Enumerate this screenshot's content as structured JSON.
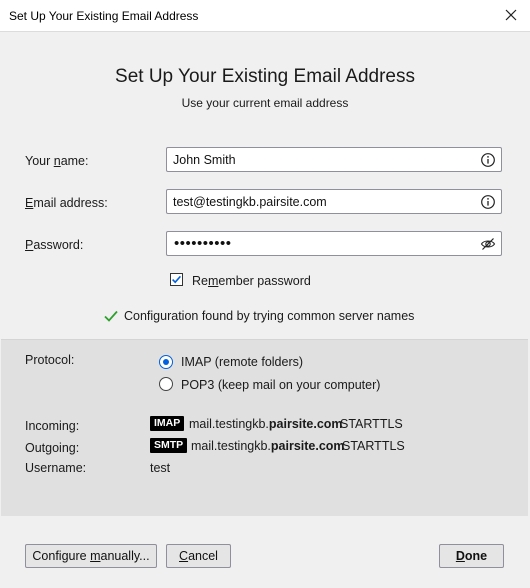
{
  "window": {
    "title": "Set Up Your Existing Email Address"
  },
  "header": {
    "title": "Set Up Your Existing Email Address",
    "subtitle": "Use your current email address"
  },
  "form": {
    "name": {
      "label_pre": "Your ",
      "label_key": "n",
      "label_post": "ame:",
      "value": "John Smith",
      "icon": "info-icon"
    },
    "email": {
      "label_pre": "",
      "label_key": "E",
      "label_post": "mail address:",
      "value": "test@testingkb.pairsite.com",
      "icon": "info-icon"
    },
    "password": {
      "label_pre": "",
      "label_key": "P",
      "label_post": "assword:",
      "value": "••••••••••",
      "icon": "eye-slash-icon"
    },
    "remember": {
      "label_pre": "Re",
      "label_key": "m",
      "label_post": "ember password",
      "checked": true
    }
  },
  "status": {
    "icon": "checkmark-icon",
    "text": "Configuration found by trying common server names",
    "color": "#2ca02c"
  },
  "config": {
    "protocol_label": "Protocol:",
    "options": [
      {
        "label": "IMAP (remote folders)",
        "selected": true
      },
      {
        "label": "POP3 (keep mail on your computer)",
        "selected": false
      }
    ],
    "incoming": {
      "label": "Incoming:",
      "badge": "IMAP",
      "host_pre": "mail.testingkb.",
      "host_bold": "pairsite.com",
      "security": "STARTTLS"
    },
    "outgoing": {
      "label": "Outgoing:",
      "badge": "SMTP",
      "host_pre": "mail.testingkb.",
      "host_bold": "pairsite.com",
      "security": "STARTTLS"
    },
    "username": {
      "label": "Username:",
      "value": "test"
    }
  },
  "buttons": {
    "configure": {
      "pre": "Configure ",
      "key": "m",
      "post": "anually..."
    },
    "cancel": {
      "pre": "",
      "key": "C",
      "post": "ancel"
    },
    "done": {
      "pre": "",
      "key": "D",
      "post": "one"
    }
  },
  "colors": {
    "accent": "#0060df",
    "panel": "#e0e0e0",
    "background": "#f0f0f0"
  }
}
